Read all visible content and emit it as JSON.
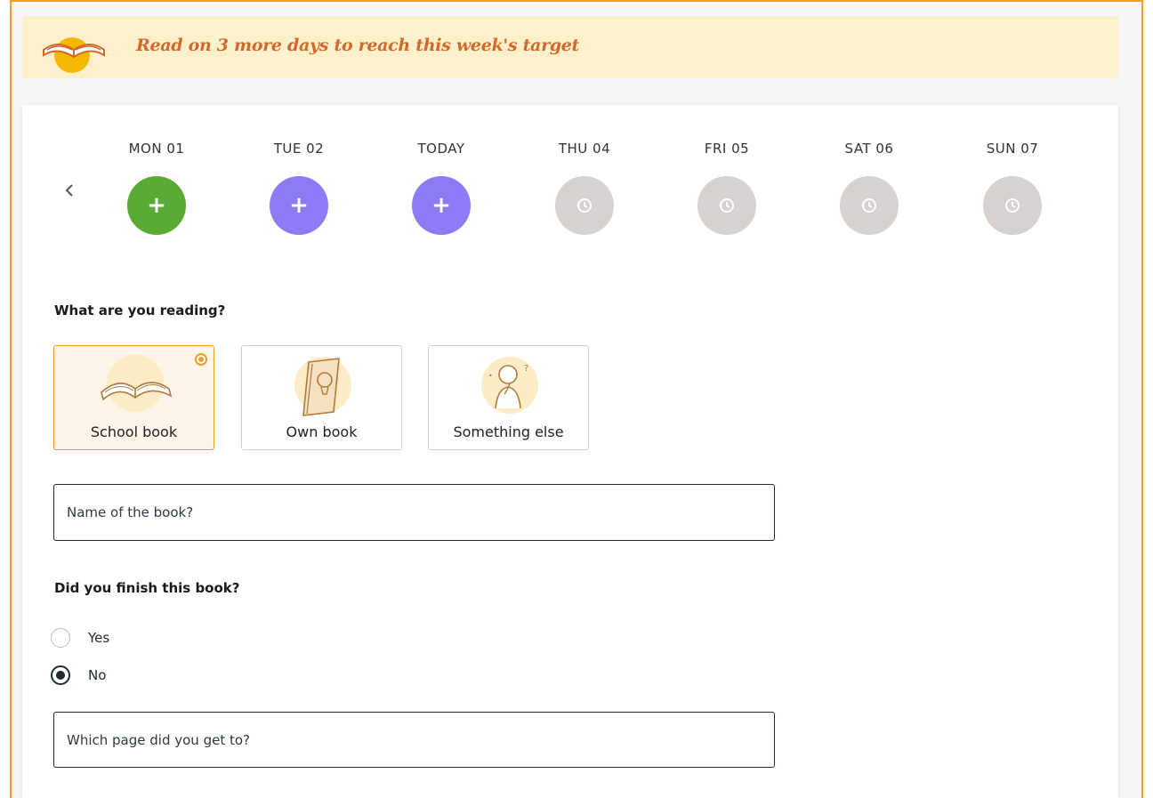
{
  "banner": {
    "icon": "open-book-icon",
    "message": "Read on 3 more days to reach this week's target"
  },
  "week": {
    "prev_icon": "chevron-left-icon",
    "days": [
      {
        "label": "MON 01",
        "state": "completed",
        "icon": "plus-icon",
        "color": "#5aab34"
      },
      {
        "label": "TUE 02",
        "state": "available",
        "icon": "plus-icon",
        "color": "#8a7cf5"
      },
      {
        "label": "TODAY",
        "state": "available",
        "icon": "plus-icon",
        "color": "#8a7cf5"
      },
      {
        "label": "THU 04",
        "state": "future",
        "icon": "clock-icon",
        "color": "#d6d2cd"
      },
      {
        "label": "FRI 05",
        "state": "future",
        "icon": "clock-icon",
        "color": "#d6d2cd"
      },
      {
        "label": "SAT 06",
        "state": "future",
        "icon": "clock-icon",
        "color": "#d6d2cd"
      },
      {
        "label": "SUN 07",
        "state": "future",
        "icon": "clock-icon",
        "color": "#d6d2cd"
      }
    ]
  },
  "reading_question": "What are you reading?",
  "reading_options": [
    {
      "label": "School book",
      "icon": "open-book-icon",
      "selected": true
    },
    {
      "label": "Own book",
      "icon": "notebook-lightbulb-icon",
      "selected": false
    },
    {
      "label": "Something else",
      "icon": "thinking-person-icon",
      "selected": false
    }
  ],
  "book_name_field": {
    "placeholder": "Name of the book?",
    "value": ""
  },
  "finish_question": "Did you finish this book?",
  "finish_options": [
    {
      "label": "Yes",
      "checked": false
    },
    {
      "label": "No",
      "checked": true
    }
  ],
  "page_field": {
    "placeholder": "Which page did you get to?",
    "value": ""
  },
  "colors": {
    "accent": "#f0a020",
    "banner_bg": "#fdf1cc",
    "banner_text": "#d2692a",
    "completed": "#5aab34",
    "available": "#8a7cf5",
    "future": "#d6d2cd"
  }
}
